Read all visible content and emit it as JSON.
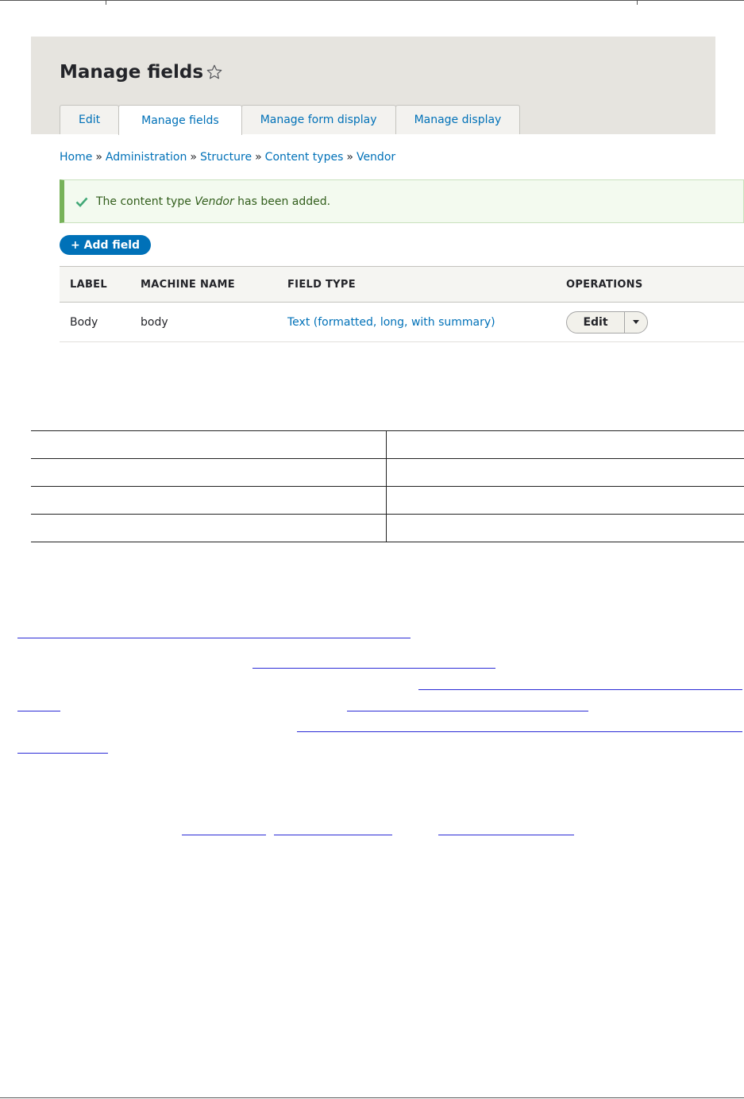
{
  "header": {
    "title": "Manage fields"
  },
  "tabs": [
    {
      "label": "Edit",
      "active": false
    },
    {
      "label": "Manage fields",
      "active": true
    },
    {
      "label": "Manage form display",
      "active": false
    },
    {
      "label": "Manage display",
      "active": false
    }
  ],
  "breadcrumb": {
    "items": [
      "Home",
      "Administration",
      "Structure",
      "Content types",
      "Vendor"
    ],
    "separator": "»"
  },
  "status": {
    "prefix": "The content type ",
    "name": "Vendor",
    "suffix": " has been added."
  },
  "add_field_button": "+ Add field",
  "fields_table": {
    "headers": [
      "LABEL",
      "MACHINE NAME",
      "FIELD TYPE",
      "OPERATIONS"
    ],
    "rows": [
      {
        "label": "Body",
        "machine_name": "body",
        "field_type": "Text (formatted, long, with summary)",
        "operation": "Edit"
      }
    ]
  },
  "colors": {
    "link": "#0071b8",
    "status_border": "#77b259",
    "header_bg": "#e6e4df"
  },
  "icons": [
    "star-icon",
    "check-icon",
    "caret-down-icon"
  ]
}
